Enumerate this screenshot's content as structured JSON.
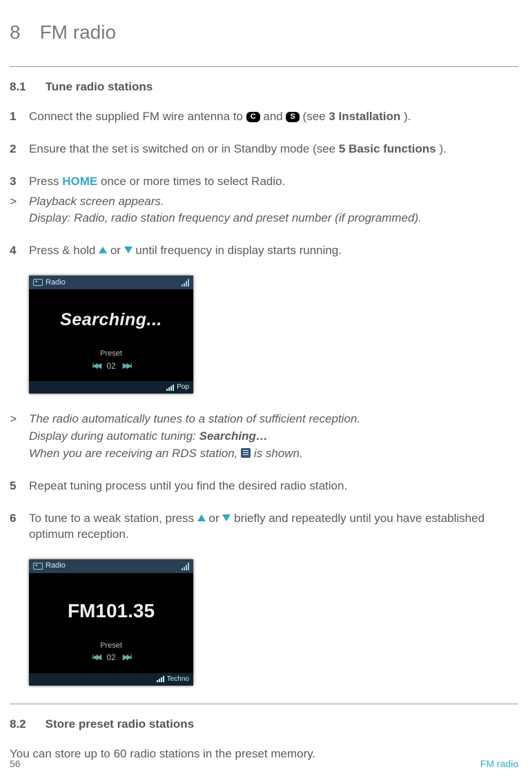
{
  "chapter": {
    "number": "8",
    "title": "FM radio"
  },
  "section1": {
    "number": "8.1",
    "title": "Tune radio stations"
  },
  "step1": {
    "marker": "1",
    "t1": "Connect the supplied FM wire antenna to ",
    "badgeC": "C",
    "t2": " and ",
    "badgeS": "S",
    "t3": " (see ",
    "bold": "3 Installation",
    "t4": ")."
  },
  "step2": {
    "marker": "2",
    "t1": "Ensure that the set is switched on or in Standby mode (see ",
    "bold": "5 Basic functions",
    "t2": ")."
  },
  "step3": {
    "marker": "3",
    "t1": "Press ",
    "home": "HOME",
    "t2": " once or more times to select Radio."
  },
  "result3": {
    "marker": ">",
    "l1": "Playback screen appears.",
    "l2": "Display: Radio, radio station frequency and preset number (if programmed)."
  },
  "step4": {
    "marker": "4",
    "t1": "Press & hold ",
    "t2": " or ",
    "t3": " until frequency in display starts running."
  },
  "device1": {
    "header": "Radio",
    "main": "Searching...",
    "presetLabel": "Preset",
    "presetNum": "02",
    "genre": "Pop"
  },
  "result4": {
    "marker": ">",
    "l1": "The radio automatically tunes to a station of sufficient reception.",
    "l2a": "Display during automatic tuning: ",
    "l2b": "Searching…",
    "l3a": "When you are receiving an RDS station, ",
    "l3b": " is shown."
  },
  "step5": {
    "marker": "5",
    "t1": "Repeat tuning process until you find the desired radio station."
  },
  "step6": {
    "marker": "6",
    "t1": "To tune to a weak station, press ",
    "t2": " or ",
    "t3": " briefly and repeatedly until you have established optimum reception."
  },
  "device2": {
    "header": "Radio",
    "main": "FM101.35",
    "presetLabel": "Preset",
    "presetNum": "02",
    "genre": "Techno"
  },
  "section2": {
    "number": "8.2",
    "title": "Store preset radio stations"
  },
  "section2_body": "You can store up to 60 radio stations in the preset memory.",
  "footer": {
    "page": "56",
    "label": "FM radio"
  }
}
